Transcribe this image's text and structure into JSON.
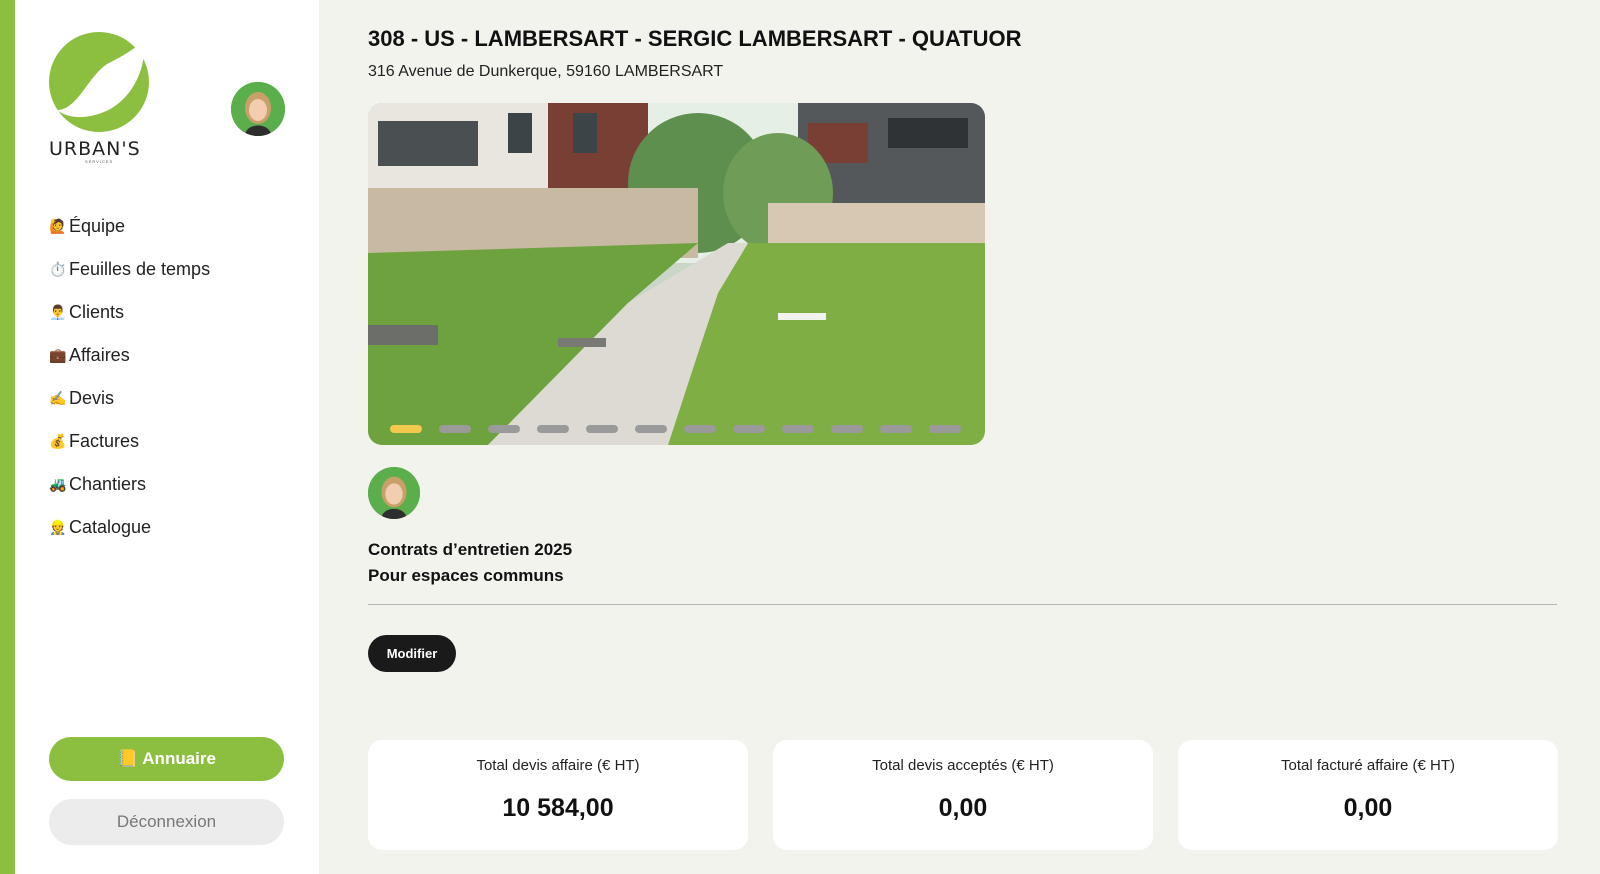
{
  "brand": {
    "name": "URBAN'S",
    "subtitle": "SERVICES",
    "accent_color": "#8cbf3f"
  },
  "sidebar": {
    "items": [
      {
        "icon": "🙋",
        "icon_name": "raising-hand-icon",
        "label": "Équipe"
      },
      {
        "icon": "⏱️",
        "icon_name": "stopwatch-icon",
        "label": "Feuilles de temps"
      },
      {
        "icon": "👨‍💼",
        "icon_name": "office-worker-icon",
        "label": "Clients"
      },
      {
        "icon": "💼",
        "icon_name": "briefcase-icon",
        "label": "Affaires"
      },
      {
        "icon": "✍️",
        "icon_name": "writing-hand-icon",
        "label": "Devis"
      },
      {
        "icon": "💰",
        "icon_name": "money-bag-icon",
        "label": "Factures"
      },
      {
        "icon": "🚜",
        "icon_name": "tractor-icon",
        "label": "Chantiers"
      },
      {
        "icon": "👷",
        "icon_name": "construction-worker-icon",
        "label": "Catalogue"
      }
    ],
    "annuaire_icon": "📒",
    "annuaire_label": "Annuaire",
    "logout_label": "Déconnexion"
  },
  "main": {
    "title": "308 - US - LAMBERSART - SERGIC LAMBERSART - QUATUOR",
    "address": "316 Avenue de Dunkerque, 59160 LAMBERSART",
    "carousel": {
      "slide_count": 12,
      "active_index": 0
    },
    "description_line1": "Contrats d’entretien 2025",
    "description_line2": "Pour espaces communs",
    "edit_label": "Modifier",
    "stats": [
      {
        "label": "Total devis affaire (€ HT)",
        "value": "10 584,00"
      },
      {
        "label": "Total devis acceptés (€ HT)",
        "value": "0,00"
      },
      {
        "label": "Total facturé affaire (€ HT)",
        "value": "0,00"
      }
    ]
  }
}
